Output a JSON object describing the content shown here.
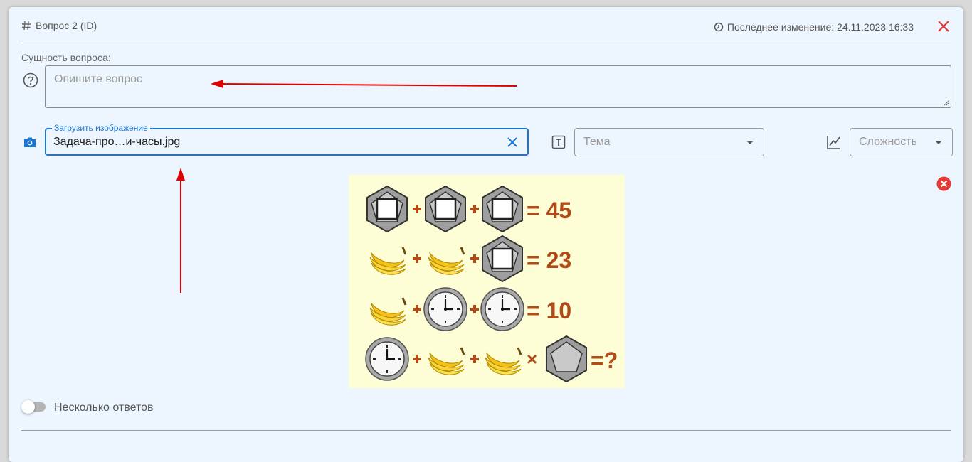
{
  "header": {
    "question_id": "Вопрос 2 (ID)",
    "last_modified": "Последнее изменение: 24.11.2023 16:33"
  },
  "essence": {
    "label": "Сущность вопроса:",
    "placeholder": "Опишите вопрос",
    "value": ""
  },
  "image_upload": {
    "label": "Загрузить изображение",
    "value": "Задача-про…и-часы.jpg"
  },
  "topic": {
    "placeholder": "Тема"
  },
  "difficulty": {
    "placeholder": "Сложность"
  },
  "puzzle_image": {
    "rows": [
      {
        "terms": [
          "hexagon-square",
          "hexagon-square",
          "hexagon-square"
        ],
        "ops": [
          "+",
          "+"
        ],
        "result": "= 45"
      },
      {
        "terms": [
          "bananas",
          "bananas",
          "hexagon-square"
        ],
        "ops": [
          "+",
          "+"
        ],
        "result": "= 23"
      },
      {
        "terms": [
          "bananas",
          "clock",
          "clock"
        ],
        "ops": [
          "+",
          "+"
        ],
        "result": "= 10"
      },
      {
        "terms": [
          "clock",
          "bananas",
          "bananas",
          "hexagon-pentagon"
        ],
        "ops": [
          "+",
          "+",
          "×"
        ],
        "result": "=?"
      }
    ]
  },
  "multiple_answers": {
    "label": "Несколько ответов",
    "enabled": false
  },
  "colors": {
    "accent": "#1976d2",
    "close": "#e53935",
    "annotation_arrow": "#e00000",
    "puzzle_text": "#b24b1a"
  }
}
